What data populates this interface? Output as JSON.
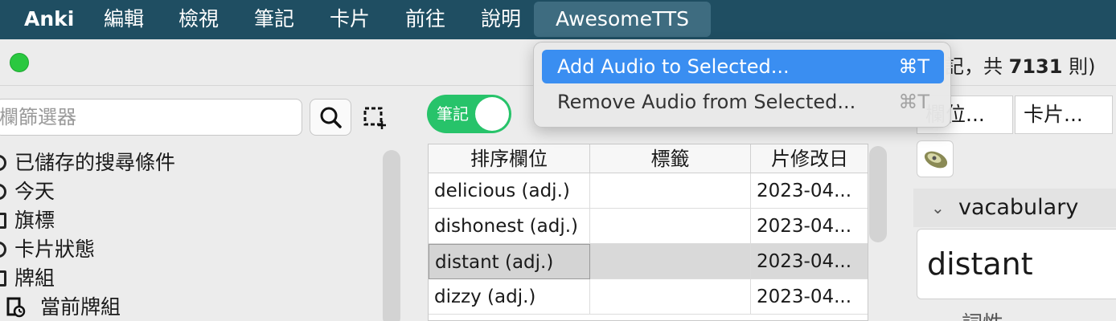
{
  "menubar": {
    "app": "Anki",
    "items": [
      "編輯",
      "檢視",
      "筆記",
      "卡片",
      "前往",
      "說明",
      "AwesomeTTS"
    ]
  },
  "window": {
    "title_prefix": "記，共 ",
    "note_count": "7131",
    "title_suffix": " 則)"
  },
  "sidebar": {
    "search_placeholder": "欄篩選器",
    "items": [
      "已儲存的搜尋條件",
      "今天",
      "旗標",
      "卡片狀態",
      "牌組",
      "當前牌組"
    ]
  },
  "toggle": {
    "label": "筆記"
  },
  "table": {
    "columns": [
      "排序欄位",
      "標籤",
      "片修改日"
    ],
    "rows": [
      {
        "sort": "delicious (adj.)",
        "tags": "",
        "modified": "2023-04...",
        "selected": false
      },
      {
        "sort": "dishonest (adj.)",
        "tags": "",
        "modified": "2023-04...",
        "selected": false
      },
      {
        "sort": "distant (adj.)",
        "tags": "",
        "modified": "2023-04...",
        "selected": true
      },
      {
        "sort": "dizzy (adj.)",
        "tags": "",
        "modified": "2023-04...",
        "selected": false
      }
    ]
  },
  "editor": {
    "tabs": [
      "欄位...",
      "卡片..."
    ],
    "field_name": "vacabulary",
    "field_value": "distant",
    "next_field": "詞性"
  },
  "dropdown": {
    "items": [
      {
        "label": "Add Audio to Selected...",
        "shortcut": "⌘T",
        "highlighted": true
      },
      {
        "label": "Remove Audio from Selected...",
        "shortcut": "⌘T",
        "highlighted": false
      }
    ]
  },
  "colors": {
    "menubar_bg": "#1f4e62",
    "highlight": "#3a8ef1",
    "toggle_on": "#27c36a"
  }
}
